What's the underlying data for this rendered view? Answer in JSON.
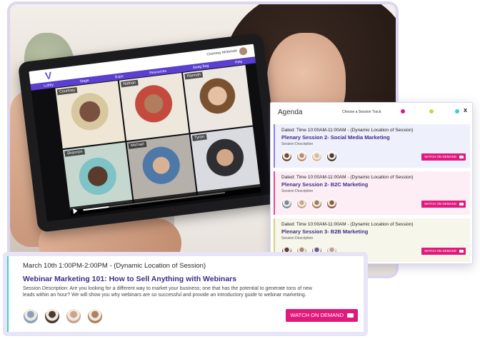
{
  "app": {
    "logo": "V",
    "user_name": "Courtney Mckenzie",
    "nav": [
      "Lobby",
      "Stage",
      "Expo",
      "Resources",
      "Swag Bag",
      "Help"
    ],
    "participants": [
      "Courtney",
      "Nathan",
      "Hannah",
      "Shannon",
      "Michael",
      "Tyron"
    ],
    "playback_progress": 0.18
  },
  "agenda": {
    "title": "Agenda",
    "track_label": "Choose a Session Track:",
    "track_colors": [
      "#e2197d",
      "#c6d84a",
      "#3ad3c4"
    ],
    "close": "x",
    "sessions": [
      {
        "time": "Dated: Time 10:00AM-11:00AM - (Dynamic Location of Session)",
        "title": "Plenary Session 2- Social Media Marketing",
        "desc": "Session Description",
        "button": "WATCH ON DEMAND",
        "avatar_colors": [
          "#6b4a3a",
          "#b98a6a",
          "#d9b7a0",
          "#4a3a30"
        ]
      },
      {
        "time": "Dated: Time 10:00AM-11:00AM - (Dynamic Location of Session)",
        "title": "Plenary Session 2- B2C Marketing",
        "desc": "Session Description",
        "button": "WATCH ON DEMAND",
        "avatar_colors": [
          "#7a8a9a",
          "#c9a58a",
          "#a07a60",
          "#8a5a3a"
        ]
      },
      {
        "time": "Dated: Time 10:00AM-11:00AM - (Dynamic Location of Session)",
        "title": "Plenary Session 3- B2B Marketing",
        "desc": "Session Description",
        "button": "WATCH ON DEMAND",
        "avatar_colors": [
          "#5a4030",
          "#a88a70",
          "#6a5a8a",
          "#c0a090"
        ]
      }
    ]
  },
  "webinar": {
    "time": "March 10th 1:00PM-2:00PM - (Dynamic Location of Session)",
    "title": "Webinar Marketing 101: How to Sell Anything with Webinars",
    "desc": "Session Description: Are you looking for a different way to market your business; one that has the potential to generate tons of new leads within an hour? We will show you why webinars are so successful and provide an introductory guide to webinar marketing.",
    "button": "WATCH ON DEMAND",
    "avatar_colors": [
      "#8aa0b8",
      "#4a3a30",
      "#c9a58a",
      "#b08060"
    ]
  }
}
